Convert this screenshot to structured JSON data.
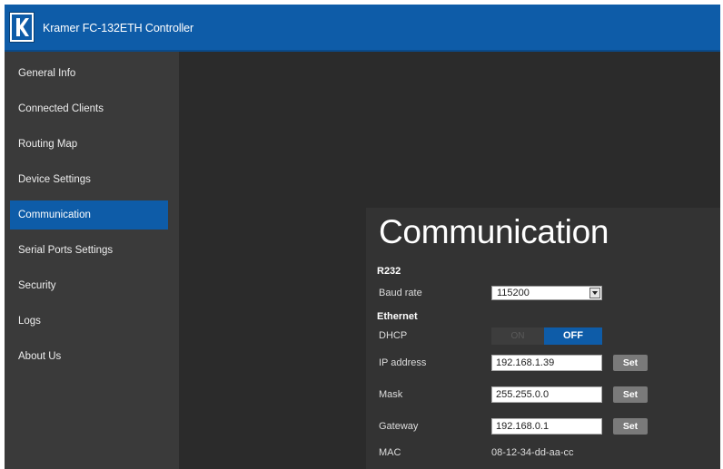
{
  "header": {
    "app_title": "Kramer FC-132ETH Controller",
    "logo_letter": "K",
    "logo_icon": "kramer-logo-icon"
  },
  "sidebar": {
    "items": [
      {
        "label": "General Info"
      },
      {
        "label": "Connected Clients"
      },
      {
        "label": "Routing Map"
      },
      {
        "label": "Device Settings"
      },
      {
        "label": "Communication",
        "active": true
      },
      {
        "label": "Serial Ports Settings"
      },
      {
        "label": "Security"
      },
      {
        "label": "Logs"
      },
      {
        "label": "About Us"
      }
    ]
  },
  "communication": {
    "title": "Communication",
    "r232": {
      "section": "R232",
      "baud_label": "Baud rate",
      "baud_value": "115200"
    },
    "ethernet": {
      "section": "Ethernet",
      "dhcp_label": "DHCP",
      "dhcp_on": "ON",
      "dhcp_off": "OFF",
      "ip_label": "IP address",
      "ip_value": "192.168.1.39",
      "mask_label": "Mask",
      "mask_value": "255.255.0.0",
      "gateway_label": "Gateway",
      "gateway_value": "192.168.0.1",
      "set_label": "Set",
      "mac_label": "MAC",
      "mac_value": "08-12-34-dd-aa-cc"
    }
  },
  "colors": {
    "accent": "#0e5ca8",
    "background": "#2b2b2b",
    "sidebar": "#3a3a3a",
    "panel": "#333333"
  }
}
